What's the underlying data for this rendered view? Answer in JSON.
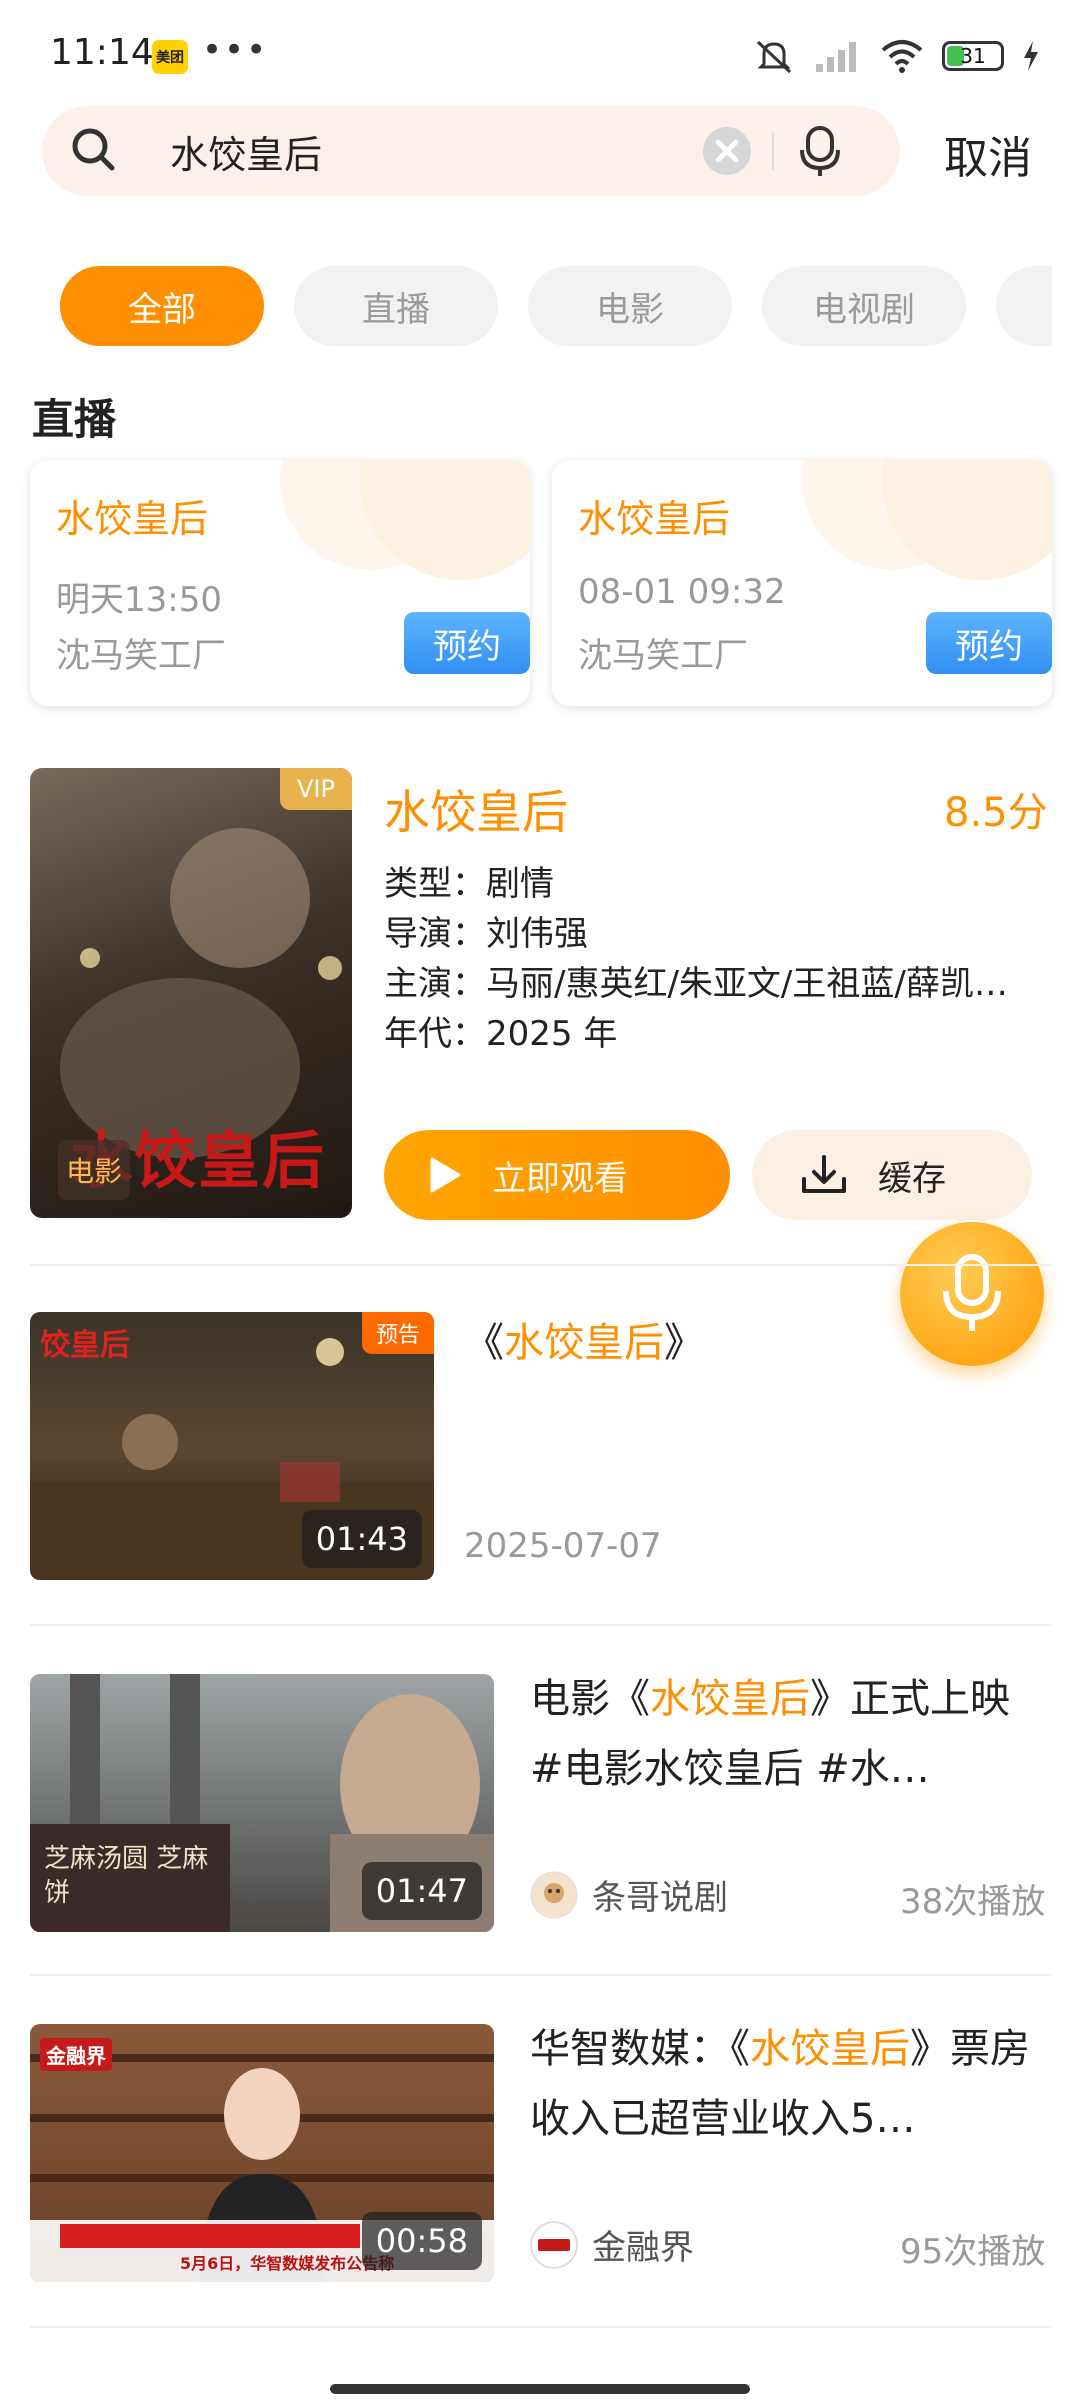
{
  "status_bar": {
    "time": "11:14",
    "app_badge": "美团",
    "dots": "•••",
    "battery": "31"
  },
  "search": {
    "query": "水饺皇后",
    "cancel_label": "取消"
  },
  "tabs": [
    "全部",
    "直播",
    "电影",
    "电视剧"
  ],
  "live": {
    "section_title": "直播",
    "cards": [
      {
        "title": "水饺皇后",
        "time": "明天13:50",
        "location": "沈马笑工厂",
        "button": "预约"
      },
      {
        "title": "水饺皇后",
        "time": "08-01 09:32",
        "location": "沈马笑工厂",
        "button": "预约"
      }
    ]
  },
  "movie": {
    "vip_tag": "VIP",
    "type_tag": "电影",
    "poster_text": "水饺皇后",
    "title": "水饺皇后",
    "score": "8.5分",
    "genre": "类型：剧情",
    "director": "导演：刘伟强",
    "cast": "主演：马丽/惠英红/朱亚文/王祖蓝/薛凯…",
    "year": "年代：2025 年",
    "watch_label": "立即观看",
    "download_label": "缓存"
  },
  "videos": [
    {
      "tag": "预告",
      "duration": "01:43",
      "title_pre": "《",
      "title_hl": "水饺皇后",
      "title_post": "》",
      "date": "2025-07-07",
      "thumb_text": "饺皇后"
    },
    {
      "duration": "01:47",
      "title_pre": "电影《",
      "title_hl": "水饺皇后",
      "title_post": "》正式上映 #电影水饺皇后  #水…",
      "author": "条哥说剧",
      "plays": "38次播放",
      "thumb_text": "芝麻汤圆 芝麻饼"
    },
    {
      "duration": "00:58",
      "title_pre": "华智数媒：《",
      "title_hl": "水饺皇后",
      "title_post": "》票房收入已超营业收入5…",
      "author": "金融界",
      "plays": "95次播放",
      "thumb_text": "5月6日，华智数媒发布公告称",
      "logo_text": "金融界"
    }
  ],
  "colors": {
    "accent": "#ff8e00",
    "reserve_blue": "#2f8ff2",
    "muted": "#999999"
  }
}
